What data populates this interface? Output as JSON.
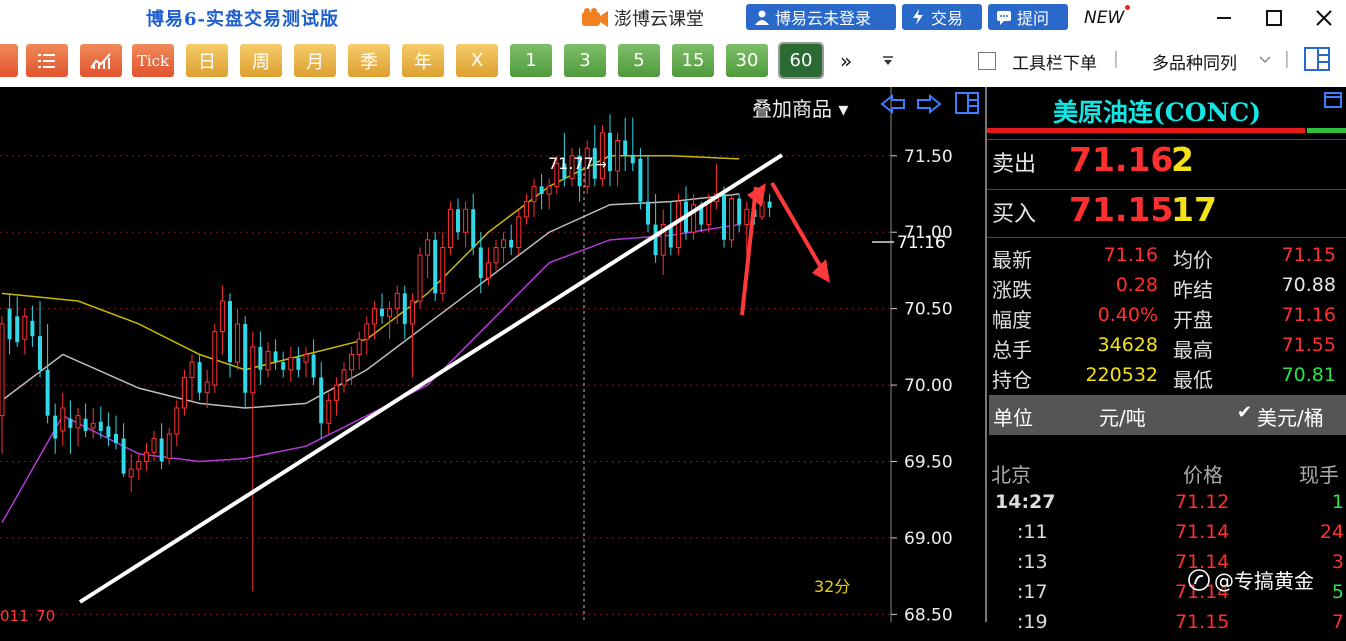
{
  "window": {
    "app_title": "博易6-实盘交易测试版",
    "brand": "澎博云课堂",
    "login_label": "博易云未登录",
    "trade_label": "交易",
    "ask_label": "提问",
    "new_label": "NEW"
  },
  "toolbar": {
    "period_buttons": [
      "Tick",
      "日",
      "周",
      "月",
      "季",
      "年",
      "X",
      "1",
      "3",
      "5",
      "15",
      "30",
      "60"
    ],
    "selected": "60",
    "more": "»",
    "tool_order": "工具栏下单",
    "multi_list": "多品种同列"
  },
  "chart": {
    "overlay_label": "叠加商品",
    "high_marker": "71.77",
    "last_price_tag": "71.16",
    "y_ticks": [
      "71.50",
      "71.00",
      "70.50",
      "70.00",
      "69.50",
      "69.00",
      "68.50"
    ],
    "bottom_left": "011_70",
    "bottom_right": "32分"
  },
  "chart_data": {
    "type": "candlestick",
    "timeframe": "60",
    "ylim": [
      68.45,
      71.95
    ],
    "y_ticks": [
      71.5,
      71.0,
      70.5,
      70.0,
      69.5,
      69.0,
      68.5
    ],
    "annotated_high": 71.77,
    "last_price": 71.16,
    "candles": [
      {
        "o": 69.8,
        "h": 70.45,
        "l": 69.55,
        "c": 70.4
      },
      {
        "o": 70.5,
        "h": 70.6,
        "l": 70.2,
        "c": 70.3
      },
      {
        "o": 70.45,
        "h": 70.58,
        "l": 70.25,
        "c": 70.28
      },
      {
        "o": 70.3,
        "h": 70.5,
        "l": 70.2,
        "c": 70.45
      },
      {
        "o": 70.42,
        "h": 70.52,
        "l": 70.25,
        "c": 70.32
      },
      {
        "o": 70.32,
        "h": 70.55,
        "l": 70.05,
        "c": 70.1
      },
      {
        "o": 70.1,
        "h": 70.4,
        "l": 69.75,
        "c": 69.8
      },
      {
        "o": 69.8,
        "h": 69.88,
        "l": 69.55,
        "c": 69.65
      },
      {
        "o": 69.7,
        "h": 69.95,
        "l": 69.6,
        "c": 69.85
      },
      {
        "o": 69.78,
        "h": 69.9,
        "l": 69.55,
        "c": 69.72
      },
      {
        "o": 69.72,
        "h": 69.85,
        "l": 69.6,
        "c": 69.8
      },
      {
        "o": 69.78,
        "h": 69.88,
        "l": 69.66,
        "c": 69.7
      },
      {
        "o": 69.72,
        "h": 69.85,
        "l": 69.65,
        "c": 69.75
      },
      {
        "o": 69.76,
        "h": 69.86,
        "l": 69.65,
        "c": 69.7
      },
      {
        "o": 69.73,
        "h": 69.82,
        "l": 69.6,
        "c": 69.66
      },
      {
        "o": 69.68,
        "h": 69.8,
        "l": 69.58,
        "c": 69.62
      },
      {
        "o": 69.65,
        "h": 69.75,
        "l": 69.4,
        "c": 69.42
      },
      {
        "o": 69.4,
        "h": 69.55,
        "l": 69.3,
        "c": 69.45
      },
      {
        "o": 69.45,
        "h": 69.55,
        "l": 69.38,
        "c": 69.5
      },
      {
        "o": 69.5,
        "h": 69.62,
        "l": 69.44,
        "c": 69.56
      },
      {
        "o": 69.56,
        "h": 69.7,
        "l": 69.5,
        "c": 69.65
      },
      {
        "o": 69.65,
        "h": 69.75,
        "l": 69.45,
        "c": 69.5
      },
      {
        "o": 69.52,
        "h": 69.72,
        "l": 69.48,
        "c": 69.68
      },
      {
        "o": 69.68,
        "h": 69.9,
        "l": 69.6,
        "c": 69.85
      },
      {
        "o": 69.85,
        "h": 70.1,
        "l": 69.8,
        "c": 70.05
      },
      {
        "o": 70.05,
        "h": 70.2,
        "l": 69.9,
        "c": 70.15
      },
      {
        "o": 70.15,
        "h": 70.2,
        "l": 69.9,
        "c": 69.95
      },
      {
        "o": 69.95,
        "h": 70.1,
        "l": 69.85,
        "c": 70.02
      },
      {
        "o": 70.0,
        "h": 70.4,
        "l": 69.95,
        "c": 70.35
      },
      {
        "o": 70.35,
        "h": 70.65,
        "l": 70.2,
        "c": 70.55
      },
      {
        "o": 70.55,
        "h": 70.6,
        "l": 70.05,
        "c": 70.15
      },
      {
        "o": 70.15,
        "h": 70.5,
        "l": 70.1,
        "c": 70.4
      },
      {
        "o": 70.4,
        "h": 70.45,
        "l": 69.85,
        "c": 69.95
      },
      {
        "o": 69.95,
        "h": 70.35,
        "l": 68.65,
        "c": 70.25
      },
      {
        "o": 70.25,
        "h": 70.35,
        "l": 70.0,
        "c": 70.1
      },
      {
        "o": 70.1,
        "h": 70.28,
        "l": 70.05,
        "c": 70.22
      },
      {
        "o": 70.22,
        "h": 70.3,
        "l": 70.1,
        "c": 70.15
      },
      {
        "o": 70.15,
        "h": 70.22,
        "l": 70.05,
        "c": 70.1
      },
      {
        "o": 70.1,
        "h": 70.25,
        "l": 70.02,
        "c": 70.18
      },
      {
        "o": 70.18,
        "h": 70.25,
        "l": 70.05,
        "c": 70.1
      },
      {
        "o": 70.15,
        "h": 70.25,
        "l": 70.05,
        "c": 70.2
      },
      {
        "o": 70.2,
        "h": 70.3,
        "l": 70.0,
        "c": 70.05
      },
      {
        "o": 70.05,
        "h": 70.15,
        "l": 69.65,
        "c": 69.75
      },
      {
        "o": 69.75,
        "h": 69.95,
        "l": 69.68,
        "c": 69.9
      },
      {
        "o": 69.9,
        "h": 70.05,
        "l": 69.8,
        "c": 70.0
      },
      {
        "o": 70.0,
        "h": 70.15,
        "l": 69.95,
        "c": 70.1
      },
      {
        "o": 70.1,
        "h": 70.25,
        "l": 70.0,
        "c": 70.2
      },
      {
        "o": 70.2,
        "h": 70.35,
        "l": 70.1,
        "c": 70.3
      },
      {
        "o": 70.3,
        "h": 70.45,
        "l": 70.2,
        "c": 70.4
      },
      {
        "o": 70.4,
        "h": 70.55,
        "l": 70.3,
        "c": 70.5
      },
      {
        "o": 70.5,
        "h": 70.6,
        "l": 70.4,
        "c": 70.45
      },
      {
        "o": 70.45,
        "h": 70.55,
        "l": 70.3,
        "c": 70.5
      },
      {
        "o": 70.5,
        "h": 70.65,
        "l": 70.4,
        "c": 70.6
      },
      {
        "o": 70.6,
        "h": 70.65,
        "l": 70.3,
        "c": 70.4
      },
      {
        "o": 70.4,
        "h": 70.6,
        "l": 70.05,
        "c": 70.55
      },
      {
        "o": 70.55,
        "h": 70.9,
        "l": 70.5,
        "c": 70.85
      },
      {
        "o": 70.85,
        "h": 71.0,
        "l": 70.7,
        "c": 70.95
      },
      {
        "o": 70.95,
        "h": 71.0,
        "l": 70.55,
        "c": 70.6
      },
      {
        "o": 70.6,
        "h": 71.0,
        "l": 70.55,
        "c": 70.9
      },
      {
        "o": 70.9,
        "h": 71.2,
        "l": 70.85,
        "c": 71.15
      },
      {
        "o": 71.15,
        "h": 71.22,
        "l": 70.95,
        "c": 71.0
      },
      {
        "o": 71.0,
        "h": 71.2,
        "l": 70.9,
        "c": 71.15
      },
      {
        "o": 71.15,
        "h": 71.25,
        "l": 70.85,
        "c": 70.9
      },
      {
        "o": 70.9,
        "h": 71.0,
        "l": 70.6,
        "c": 70.7
      },
      {
        "o": 70.7,
        "h": 70.9,
        "l": 70.65,
        "c": 70.8
      },
      {
        "o": 70.8,
        "h": 70.95,
        "l": 70.75,
        "c": 70.9
      },
      {
        "o": 70.9,
        "h": 71.0,
        "l": 70.8,
        "c": 70.95
      },
      {
        "o": 70.95,
        "h": 71.05,
        "l": 70.85,
        "c": 70.9
      },
      {
        "o": 70.9,
        "h": 71.15,
        "l": 70.85,
        "c": 71.1
      },
      {
        "o": 71.1,
        "h": 71.25,
        "l": 71.05,
        "c": 71.2
      },
      {
        "o": 71.2,
        "h": 71.35,
        "l": 71.1,
        "c": 71.3
      },
      {
        "o": 71.3,
        "h": 71.38,
        "l": 71.15,
        "c": 71.25
      },
      {
        "o": 71.25,
        "h": 71.35,
        "l": 71.15,
        "c": 71.3
      },
      {
        "o": 71.3,
        "h": 71.5,
        "l": 71.25,
        "c": 71.45
      },
      {
        "o": 71.45,
        "h": 71.65,
        "l": 71.3,
        "c": 71.35
      },
      {
        "o": 71.35,
        "h": 71.55,
        "l": 71.3,
        "c": 71.5
      },
      {
        "o": 71.5,
        "h": 71.55,
        "l": 71.2,
        "c": 71.3
      },
      {
        "o": 71.3,
        "h": 71.6,
        "l": 71.25,
        "c": 71.55
      },
      {
        "o": 71.55,
        "h": 71.7,
        "l": 71.3,
        "c": 71.35
      },
      {
        "o": 71.35,
        "h": 71.7,
        "l": 71.3,
        "c": 71.65
      },
      {
        "o": 71.65,
        "h": 71.77,
        "l": 71.3,
        "c": 71.4
      },
      {
        "o": 71.4,
        "h": 71.65,
        "l": 71.3,
        "c": 71.6
      },
      {
        "o": 71.6,
        "h": 71.75,
        "l": 71.4,
        "c": 71.5
      },
      {
        "o": 71.5,
        "h": 71.75,
        "l": 71.4,
        "c": 71.45
      },
      {
        "o": 71.48,
        "h": 71.55,
        "l": 71.15,
        "c": 71.2
      },
      {
        "o": 71.2,
        "h": 71.5,
        "l": 71.0,
        "c": 71.05
      },
      {
        "o": 71.05,
        "h": 71.25,
        "l": 70.8,
        "c": 70.85
      },
      {
        "o": 70.85,
        "h": 71.15,
        "l": 70.72,
        "c": 71.05
      },
      {
        "o": 71.05,
        "h": 71.2,
        "l": 70.85,
        "c": 70.9
      },
      {
        "o": 70.9,
        "h": 71.25,
        "l": 70.85,
        "c": 71.2
      },
      {
        "o": 71.2,
        "h": 71.3,
        "l": 70.95,
        "c": 71.0
      },
      {
        "o": 71.0,
        "h": 71.25,
        "l": 70.95,
        "c": 71.18
      },
      {
        "o": 71.18,
        "h": 71.2,
        "l": 71.0,
        "c": 71.05
      },
      {
        "o": 71.05,
        "h": 71.25,
        "l": 71.0,
        "c": 71.2
      },
      {
        "o": 71.2,
        "h": 71.45,
        "l": 71.15,
        "c": 71.25
      },
      {
        "o": 71.25,
        "h": 71.3,
        "l": 70.9,
        "c": 70.95
      },
      {
        "o": 70.95,
        "h": 71.25,
        "l": 70.9,
        "c": 71.22
      },
      {
        "o": 71.22,
        "h": 71.25,
        "l": 71.0,
        "c": 71.05
      },
      {
        "o": 71.05,
        "h": 71.2,
        "l": 70.8,
        "c": 71.15
      },
      {
        "o": 71.15,
        "h": 71.25,
        "l": 71.05,
        "c": 71.1
      },
      {
        "o": 71.1,
        "h": 71.25,
        "l": 71.08,
        "c": 71.2
      },
      {
        "o": 71.2,
        "h": 71.25,
        "l": 71.1,
        "c": 71.16
      }
    ],
    "bands": {
      "upper": [
        [
          0,
          70.6
        ],
        [
          10,
          70.55
        ],
        [
          18,
          70.4
        ],
        [
          26,
          70.2
        ],
        [
          32,
          70.1
        ],
        [
          40,
          70.2
        ],
        [
          48,
          70.3
        ],
        [
          56,
          70.6
        ],
        [
          64,
          71.0
        ],
        [
          72,
          71.3
        ],
        [
          80,
          71.5
        ],
        [
          88,
          71.5
        ],
        [
          97,
          71.48
        ]
      ],
      "middle": [
        [
          0,
          69.9
        ],
        [
          8,
          70.2
        ],
        [
          18,
          69.98
        ],
        [
          26,
          69.88
        ],
        [
          32,
          69.85
        ],
        [
          40,
          69.88
        ],
        [
          48,
          70.1
        ],
        [
          56,
          70.4
        ],
        [
          64,
          70.7
        ],
        [
          72,
          71.0
        ],
        [
          80,
          71.18
        ],
        [
          88,
          71.2
        ],
        [
          97,
          71.25
        ]
      ],
      "lower": [
        [
          0,
          69.1
        ],
        [
          8,
          69.8
        ],
        [
          18,
          69.55
        ],
        [
          26,
          69.5
        ],
        [
          32,
          69.52
        ],
        [
          40,
          69.6
        ],
        [
          48,
          69.8
        ],
        [
          56,
          70.0
        ],
        [
          64,
          70.4
        ],
        [
          72,
          70.8
        ],
        [
          80,
          70.95
        ],
        [
          88,
          70.98
        ],
        [
          97,
          71.05
        ]
      ]
    },
    "band_colors": {
      "upper": "#c8b800",
      "middle": "#bdbdbd",
      "lower": "#b23ad6"
    },
    "up_color": "#ff3030",
    "down_color": "#30d8e8"
  },
  "quote": {
    "symbol": "美原油连(CONC)",
    "sell_label": "卖出",
    "sell_price": "71.16",
    "sell_vol": "2",
    "buy_label": "买入",
    "buy_price": "71.15",
    "buy_vol": "17",
    "stats": [
      {
        "l1": "最新",
        "v1": "71.16",
        "c1": "#ff2f2f",
        "l2": "均价",
        "v2": "71.15",
        "c2": "#ff2f2f"
      },
      {
        "l1": "涨跌",
        "v1": "0.28",
        "c1": "#ff2f2f",
        "l2": "昨结",
        "v2": "70.88",
        "c2": "#e6e6e6"
      },
      {
        "l1": "幅度",
        "v1": "0.40%",
        "c1": "#ff2f2f",
        "l2": "开盘",
        "v2": "71.16",
        "c2": "#ff2f2f"
      },
      {
        "l1": "总手",
        "v1": "34628",
        "c1": "#f3e217",
        "l2": "最高",
        "v2": "71.55",
        "c2": "#ff2f2f"
      },
      {
        "l1": "持仓",
        "v1": "220532",
        "c1": "#f3e217",
        "l2": "最低",
        "v2": "70.81",
        "c2": "#2ee04a"
      }
    ],
    "unit_label": "单位",
    "unit_cny": "元/吨",
    "unit_usd": "美元/桶",
    "tick_head": {
      "place": "北京",
      "price": "价格",
      "vol": "现手"
    },
    "ticks": [
      {
        "t": "14:27",
        "p": "71.12",
        "v": "1",
        "vc": "#2ee04a"
      },
      {
        "t": ":11",
        "p": "71.14",
        "v": "24",
        "vc": "#ff2f2f"
      },
      {
        "t": ":13",
        "p": "71.14",
        "v": "3",
        "vc": "#ff2f2f"
      },
      {
        "t": ":17",
        "p": "71.14",
        "v": "5",
        "vc": "#2ee04a"
      },
      {
        "t": ":19",
        "p": "71.15",
        "v": "7",
        "vc": "#ff2f2f"
      }
    ]
  },
  "watermark": "@专搞黄金"
}
